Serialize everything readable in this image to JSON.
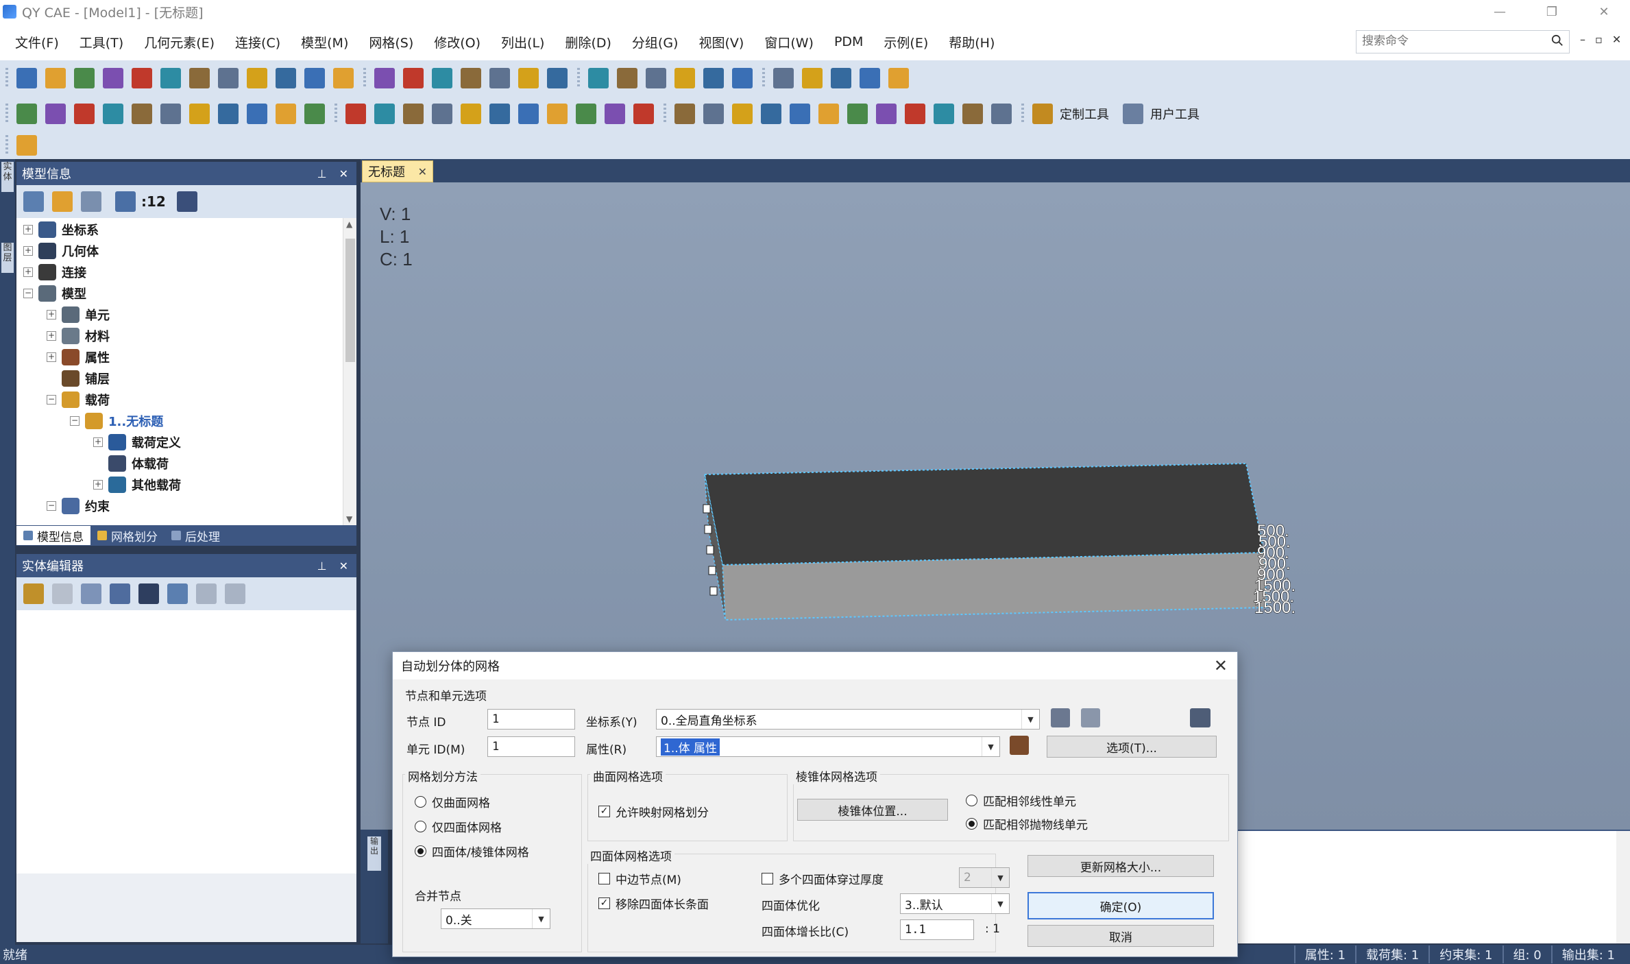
{
  "window": {
    "title": "QY CAE - [Model1] - [无标题]",
    "min": "—",
    "restore": "❐",
    "close": "✕"
  },
  "menu": [
    "文件(F)",
    "工具(T)",
    "几何元素(E)",
    "连接(C)",
    "模型(M)",
    "网格(S)",
    "修改(O)",
    "列出(L)",
    "删除(D)",
    "分组(G)",
    "视图(V)",
    "窗口(W)",
    "PDM",
    "示例(E)",
    "帮助(H)"
  ],
  "search": {
    "placeholder": "搜索命令"
  },
  "mdi_buttons": [
    "–",
    "▫",
    "✕"
  ],
  "toolbar": {
    "custom_tools": "定制工具",
    "user_tools": "用户工具"
  },
  "left_strip": {
    "tab1": "实体",
    "tab2": "图层"
  },
  "model_info": {
    "title": "模型信息",
    "count": ":12",
    "pin": "⊥",
    "close": "✕",
    "tree": [
      {
        "label": "坐标系",
        "level": 0,
        "expander": "+"
      },
      {
        "label": "几何体",
        "level": 0,
        "expander": "+"
      },
      {
        "label": "连接",
        "level": 0,
        "expander": "+"
      },
      {
        "label": "模型",
        "level": 0,
        "expander": "−"
      },
      {
        "label": "单元",
        "level": 1,
        "expander": "+"
      },
      {
        "label": "材料",
        "level": 1,
        "expander": "+"
      },
      {
        "label": "属性",
        "level": 1,
        "expander": "+"
      },
      {
        "label": "铺层",
        "level": 1,
        "expander": ""
      },
      {
        "label": "载荷",
        "level": 1,
        "expander": "−"
      },
      {
        "label": "1..无标题",
        "level": 2,
        "expander": "−"
      },
      {
        "label": "载荷定义",
        "level": 3,
        "expander": "+"
      },
      {
        "label": "体载荷",
        "level": 3,
        "expander": ""
      },
      {
        "label": "其他载荷",
        "level": 3,
        "expander": "+"
      },
      {
        "label": "约束",
        "level": 1,
        "expander": "−"
      }
    ],
    "tabs": [
      "模型信息",
      "网格划分",
      "后处理"
    ]
  },
  "entity_editor": {
    "title": "实体编辑器",
    "pin": "⊥",
    "close": "✕"
  },
  "document": {
    "tab": "无标题",
    "close": "✕"
  },
  "viewport": {
    "info": [
      "V: 1",
      "L: 1",
      "C: 1"
    ],
    "load_labels": [
      "500.",
      "500.",
      "900.",
      "900.",
      "900.",
      "1500.",
      "1500.",
      "1500."
    ]
  },
  "output": {
    "label": "输出"
  },
  "status": {
    "ready": "就绪",
    "items": [
      "属性: 1",
      "载荷集: 1",
      "约束集: 1",
      "组: 0",
      "输出集: 1"
    ]
  },
  "dialog": {
    "title": "自动划分体的网格",
    "close": "✕",
    "node_elem_group": "节点和单元选项",
    "node_id_label": "节点  ID",
    "node_id": "1",
    "elem_id_label": "单元  ID(M)",
    "elem_id": "1",
    "coord_label": "坐标系(Y)",
    "coord_value": "0..全局直角坐标系",
    "prop_label": "属性(R)",
    "prop_value": "1..体 属性",
    "options_btn": "选项(T)...",
    "method_group": "网格划分方法",
    "method_surface": "仅曲面网格",
    "method_tet": "仅四面体网格",
    "method_tet_pyr": "四面体/棱锥体网格",
    "merge_label": "合并节点",
    "merge_value": "0..关",
    "surface_group": "曲面网格选项",
    "allow_mapped": "允许映射网格划分",
    "pyramid_group": "棱锥体网格选项",
    "pyramid_btn": "棱锥体位置...",
    "match_linear": "匹配相邻线性单元",
    "match_parabolic": "匹配相邻抛物线单元",
    "update_size_btn": "更新网格大小...",
    "tet_group": "四面体网格选项",
    "midside": "中边节点(M)",
    "remove_long": "移除四面体长条面",
    "multi_tet": "多个四面体穿过厚度",
    "multi_tet_value": "2",
    "tet_opt_label": "四面体优化",
    "tet_opt_value": "3..默认",
    "growth_label": "四面体增长比(C)",
    "growth_value": "1.1",
    "growth_suffix": ": 1",
    "ok": "确定(O)",
    "cancel": "取消"
  },
  "colors": {
    "panel_title": "#3d5682",
    "toolbar": "#d9e3f0",
    "selection": "#2f67d2"
  }
}
